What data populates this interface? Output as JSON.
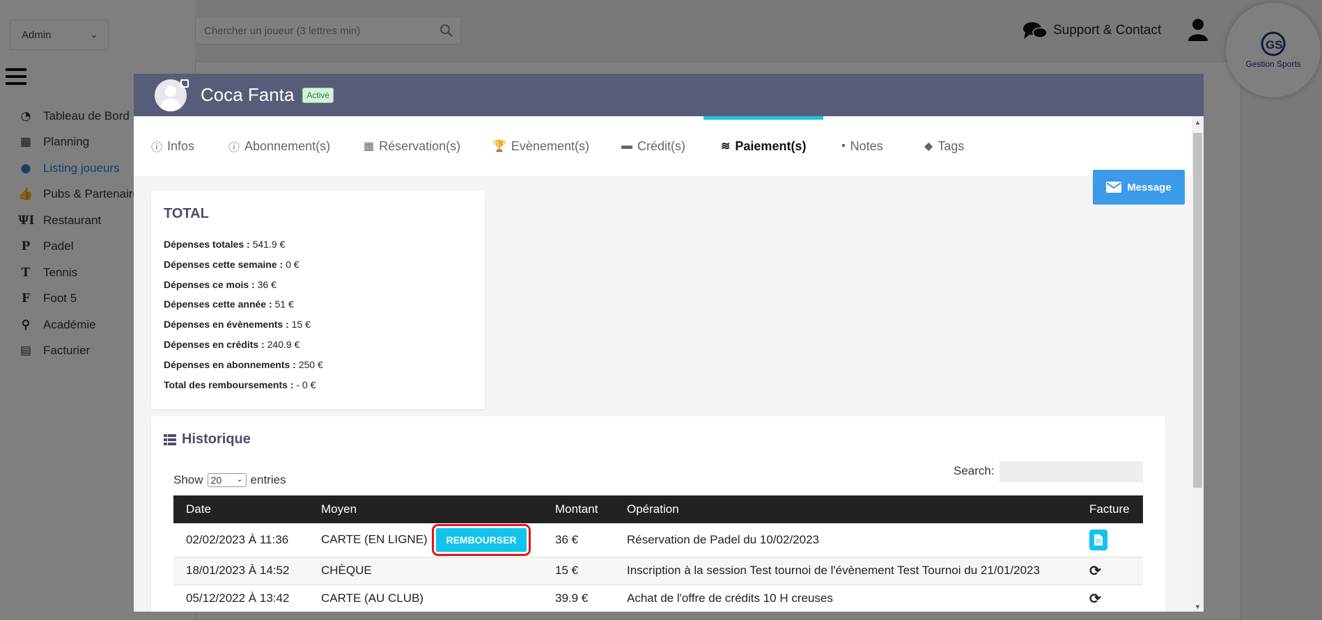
{
  "app": {
    "admin_select": "Admin",
    "search_placeholder": "Chercher un joueur (3 lettres min)",
    "support_label": "Support & Contact",
    "logo_text": "Gestion Sports",
    "menu": [
      {
        "label": "Tableau de Bord",
        "icon": "dashboard-icon"
      },
      {
        "label": "Planning",
        "icon": "calendar-icon"
      },
      {
        "label": "Listing joueurs",
        "icon": "user-icon",
        "active": true
      },
      {
        "label": "Pubs & Partenaires",
        "icon": "thumbs-up-icon"
      },
      {
        "label": "Restaurant",
        "icon": "utensils-icon"
      },
      {
        "label": "Padel",
        "icon": "letter-p-icon"
      },
      {
        "label": "Tennis",
        "icon": "letter-t-icon"
      },
      {
        "label": "Foot 5",
        "icon": "letter-f-icon"
      },
      {
        "label": "Académie",
        "icon": "child-icon"
      },
      {
        "label": "Facturier",
        "icon": "invoice-icon"
      }
    ]
  },
  "modal": {
    "player_name": "Coca Fanta",
    "status_badge": "Activé",
    "tabs": [
      {
        "label": "Infos",
        "icon": "info-icon"
      },
      {
        "label": "Abonnement(s)",
        "icon": "info-icon"
      },
      {
        "label": "Réservation(s)",
        "icon": "calendar-icon"
      },
      {
        "label": "Evènement(s)",
        "icon": "trophy-icon"
      },
      {
        "label": "Crédit(s)",
        "icon": "credit-card-icon"
      },
      {
        "label": "Paiement(s)",
        "icon": "coins-icon",
        "active": true
      },
      {
        "label": "Notes",
        "icon": "comment-icon"
      },
      {
        "label": "Tags",
        "icon": "tag-icon"
      }
    ],
    "message_button": "Message",
    "total": {
      "title": "TOTAL",
      "stats": [
        {
          "label": "Dépenses totales :",
          "value": "541.9 €"
        },
        {
          "label": "Dépenses cette semaine :",
          "value": "0 €"
        },
        {
          "label": "Dépenses ce mois :",
          "value": "36 €"
        },
        {
          "label": "Dépenses cette année :",
          "value": "51 €"
        },
        {
          "label": "Dépenses en évènements :",
          "value": "15 €"
        },
        {
          "label": "Dépenses en crédits :",
          "value": "240.9 €"
        },
        {
          "label": "Dépenses en abonnements :",
          "value": "250 €"
        },
        {
          "label": "Total des remboursements :",
          "value": "- 0 €"
        }
      ]
    },
    "history": {
      "title": "Historique",
      "show_label": "Show",
      "entries_value": "20",
      "entries_label": "entries",
      "search_label": "Search:",
      "columns": [
        "Date",
        "Moyen",
        "Montant",
        "Opération",
        "Facture"
      ],
      "refund_label": "REMBOURSER",
      "rows": [
        {
          "date": "02/02/2023 À 11:36",
          "moyen": "CARTE (EN LIGNE)",
          "montant": "36 €",
          "operation": "Réservation de Padel du 10/02/2023",
          "facture": "document-icon"
        },
        {
          "date": "18/01/2023 À 14:52",
          "moyen": "CHÈQUE",
          "montant": "15 €",
          "operation": "Inscription à la session Test tournoi de l'évènement Test Tournoi du 21/01/2023",
          "facture": "sync-icon"
        },
        {
          "date": "05/12/2022 À 13:42",
          "moyen": "CARTE (AU CLUB)",
          "montant": "39.9 €",
          "operation": "Achat de l'offre de crédits 10 H creuses",
          "facture": "sync-icon"
        }
      ]
    }
  }
}
